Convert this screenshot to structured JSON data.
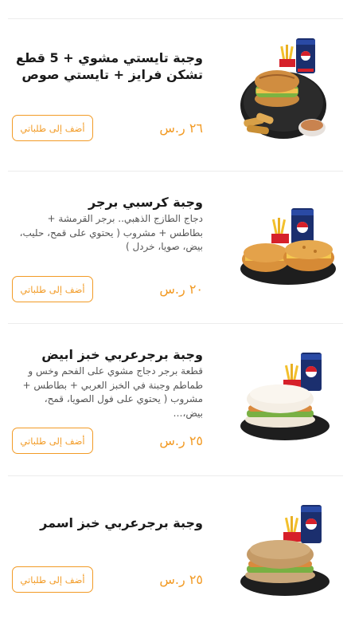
{
  "menu": {
    "items": [
      {
        "title": "وجبة تايستي مشوي + 5 قطع تشكن فرايز + تايستي صوص",
        "description": "",
        "price": "٢٦ ر.س",
        "button": "أضف إلى طلباتي",
        "image": "grilled-sandwich-nuggets-sauce-pepsi-image"
      },
      {
        "title": "وجبة كرسبي برجر",
        "description": "دجاج الطازج الذهبي.. برجر القرمشة + بطاطس + مشروب ( يحتوي على قمح، حليب، بيض، صويا، خردل )",
        "price": "٢٠ ر.س",
        "button": "أضف إلى طلباتي",
        "image": "crispy-burger-fries-pepsi-image"
      },
      {
        "title": "وجبة برجرعربي خبز ابيض",
        "description": "قطعة برجر دجاج مشوي على الفحم وخس و طماطم وجبنة في الخبز العربي + بطاطس + مشروب ( يحتوي على فول الصويا، قمح، بيض،…",
        "price": "٢٥ ر.س",
        "button": "أضف إلى طلباتي",
        "image": "arabic-burger-white-bread-image"
      },
      {
        "title": "وجبة برجرعربي خبز اسمر",
        "description": "",
        "price": "٢٥ ر.س",
        "button": "أضف إلى طلباتي",
        "image": "arabic-burger-brown-bread-image"
      }
    ]
  }
}
